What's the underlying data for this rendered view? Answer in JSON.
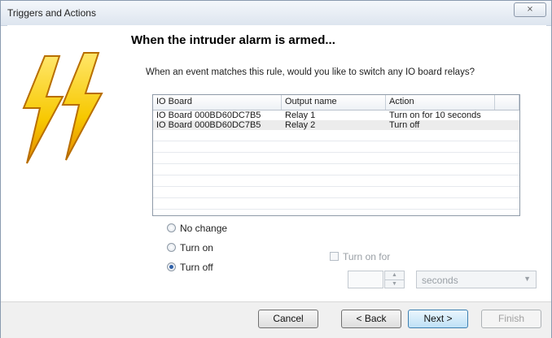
{
  "window": {
    "title": "Triggers and Actions",
    "close_glyph": "⨯"
  },
  "heading": "When the intruder alarm is armed...",
  "question": "When an event matches this rule, would you like to switch any IO board relays?",
  "grid": {
    "columns": [
      "IO Board",
      "Output name",
      "Action"
    ],
    "rows": [
      {
        "board": "IO Board 000BD60DC7B5",
        "output": "Relay 1",
        "action": "Turn on for 10 seconds"
      },
      {
        "board": "IO Board 000BD60DC7B5",
        "output": "Relay 2",
        "action": "Turn off"
      }
    ]
  },
  "radios": [
    {
      "label": "No change",
      "checked": false
    },
    {
      "label": "Turn on",
      "checked": false
    },
    {
      "label": "Turn off",
      "checked": true
    }
  ],
  "turn_on_for": {
    "label": "Turn on for",
    "checked": false,
    "units": "seconds"
  },
  "buttons": {
    "cancel": "Cancel",
    "back": "< Back",
    "next": "Next >",
    "finish": "Finish"
  },
  "icons": {
    "hero": "lightning-bolts-icon"
  },
  "colors": {
    "bolt_yellow": "#f7c800",
    "bolt_orange": "#e58a00",
    "accent_blue": "#3c7fb1"
  }
}
